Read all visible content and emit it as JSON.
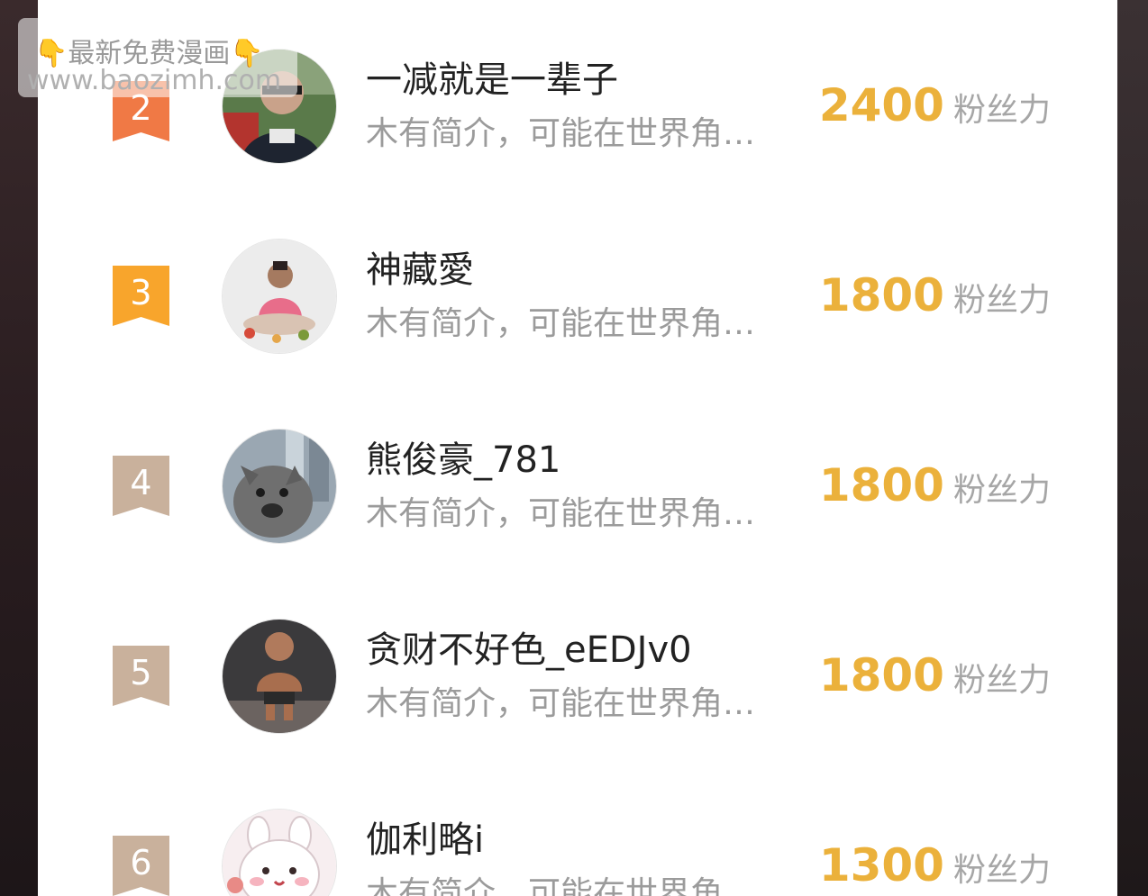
{
  "watermark": {
    "title": "最新免费漫画",
    "hand_icon": "👇",
    "url": "www.baozimh.com"
  },
  "ranking": [
    {
      "rank": "2",
      "rank_color": "#f07945",
      "name": "一减就是一辈子",
      "bio": "木有简介，可能在世界角…",
      "score": "2400",
      "unit": "粉丝力",
      "avatar": "photo-man-with-sunglasses"
    },
    {
      "rank": "3",
      "rank_color": "#f8a52c",
      "name": "神藏愛",
      "bio": "木有简介，可能在世界角…",
      "score": "1800",
      "unit": "粉丝力",
      "avatar": "photo-person-meditating"
    },
    {
      "rank": "4",
      "rank_color": "#c9b19c",
      "name": "熊俊豪_781",
      "bio": "木有简介，可能在世界角…",
      "score": "1800",
      "unit": "粉丝力",
      "avatar": "photo-cat"
    },
    {
      "rank": "5",
      "rank_color": "#c9b19c",
      "name": "贪财不好色_eEDJv0",
      "bio": "木有简介，可能在世界角…",
      "score": "1800",
      "unit": "粉丝力",
      "avatar": "photo-muscular-baby"
    },
    {
      "rank": "6",
      "rank_color": "#c9b19c",
      "name": "伽利略i",
      "bio": "木有简介，可能在世界角…",
      "score": "1300",
      "unit": "粉丝力",
      "avatar": "cartoon-bunny"
    }
  ]
}
